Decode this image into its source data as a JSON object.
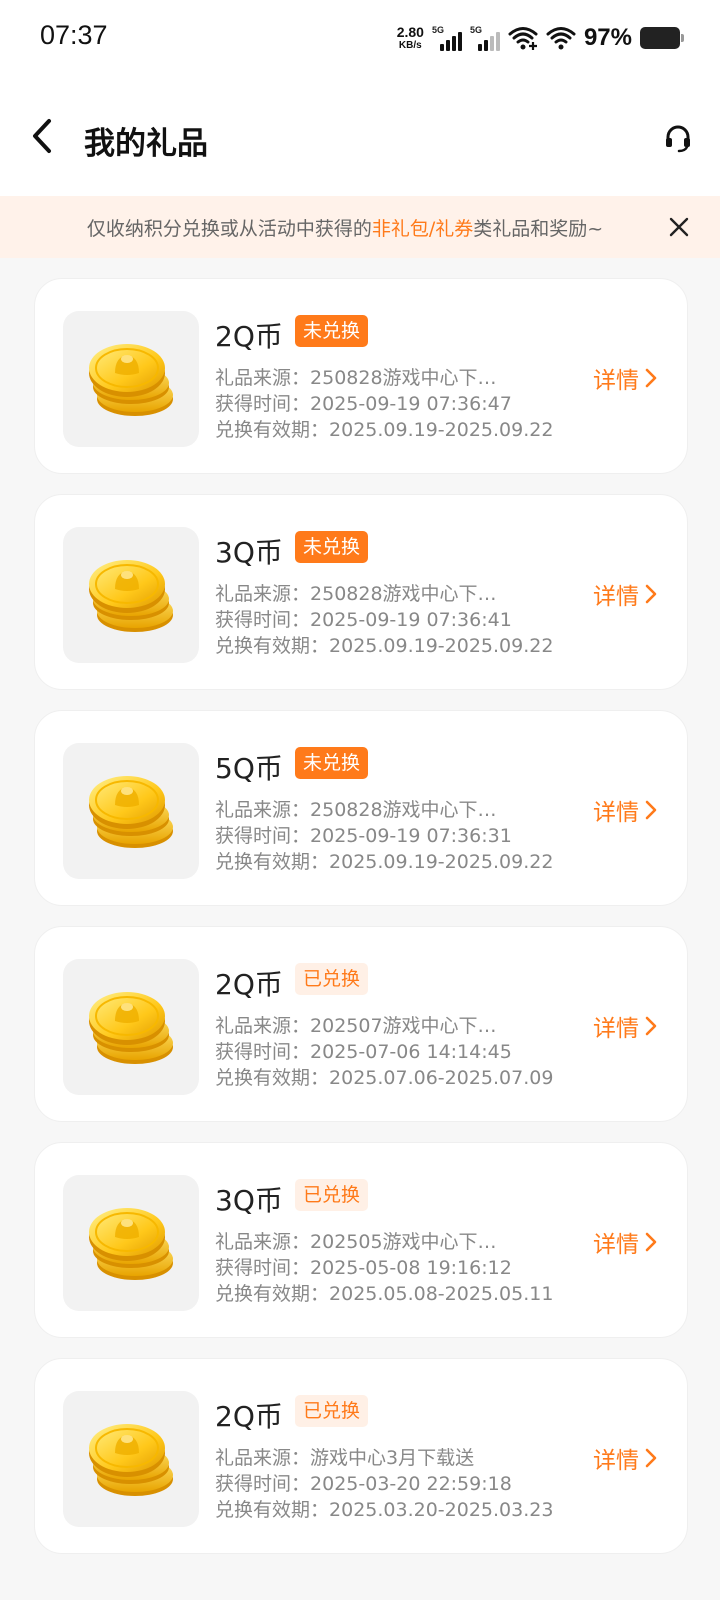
{
  "status_bar": {
    "time": "07:37",
    "net_speed_value": "2.80",
    "net_speed_unit": "KB/s",
    "signal_1_label": "5G",
    "signal_2_label": "5G",
    "battery_pct": "97%"
  },
  "header": {
    "title": "我的礼品",
    "back_icon": "chevron-left-icon",
    "service_icon": "headset-icon"
  },
  "notice": {
    "prefix": "仅收纳积分兑换或从活动中获得的",
    "highlight": "非礼包/礼券",
    "suffix": "类礼品和奖励~",
    "close_icon": "close-icon"
  },
  "labels": {
    "source": "礼品来源：",
    "time": "获得时间：",
    "validity": "兑换有效期：",
    "detail": "详情"
  },
  "gifts": [
    {
      "name": "2Q币",
      "status": "未兑换",
      "status_type": "pending",
      "source": "250828游戏中心下…",
      "time": "2025-09-19 07:36:47",
      "validity": "2025.09.19-2025.09.22"
    },
    {
      "name": "3Q币",
      "status": "未兑换",
      "status_type": "pending",
      "source": "250828游戏中心下…",
      "time": "2025-09-19 07:36:41",
      "validity": "2025.09.19-2025.09.22"
    },
    {
      "name": "5Q币",
      "status": "未兑换",
      "status_type": "pending",
      "source": "250828游戏中心下…",
      "time": "2025-09-19 07:36:31",
      "validity": "2025.09.19-2025.09.22"
    },
    {
      "name": "2Q币",
      "status": "已兑换",
      "status_type": "done",
      "source": " 202507游戏中心下…",
      "time": "2025-07-06 14:14:45",
      "validity": "2025.07.06-2025.07.09"
    },
    {
      "name": "3Q币",
      "status": "已兑换",
      "status_type": "done",
      "source": "202505游戏中心下…",
      "time": "2025-05-08 19:16:12",
      "validity": "2025.05.08-2025.05.11"
    },
    {
      "name": "2Q币",
      "status": "已兑换",
      "status_type": "done",
      "source": "游戏中心3月下载送",
      "time": "2025-03-20 22:59:18",
      "validity": "2025.03.20-2025.03.23"
    }
  ],
  "colors": {
    "accent": "#ff7a1a",
    "notice_bg": "#fff2ea",
    "page_bg": "#f7f7f7"
  }
}
